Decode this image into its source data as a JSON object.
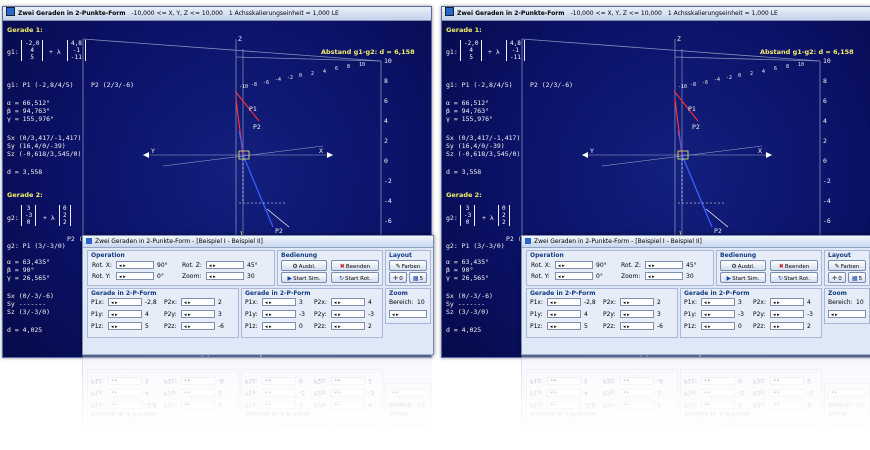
{
  "main_window": {
    "title": "Zwei Geraden in 2-Punkte-Form",
    "range_info": "-10,000 <= X, Y, Z <= 10,000",
    "scale_info": "1 Achsskalierungseinheit = 1,000 LE"
  },
  "info": {
    "gerade1_title": "Gerade 1:",
    "g1_label": "g1:",
    "g1_vec1": [
      "-2,0",
      "4",
      "5"
    ],
    "plus_lambda": "+ λ",
    "g1_vec2": [
      "4,8",
      "-1",
      "-11"
    ],
    "g1_points": "g1: P1 (-2,8/4/5)",
    "p2_label": "P2 (2/3/-6)",
    "alpha": "α = 66,512°",
    "beta": "β = 94,763°",
    "gamma": "γ = 155,976°",
    "sx1": "Sx (0/3,417/-1,417)",
    "sy1": "Sy (16,4/0/-39)",
    "sz1": "Sz (-0,618/3,545/0)",
    "d1": "d = 3,558",
    "gerade2_title": "Gerade 2:",
    "g2_label": "g2:",
    "g2_vec1": [
      "3",
      "-3",
      "0"
    ],
    "g2_vec2": [
      "0",
      "2",
      "2"
    ],
    "g2_points": "g2: P1 (3/-3/0)",
    "g2_points_right": "P2 (3/-1/2)",
    "alpha2": "α = 63,435°",
    "beta2": "β = 90°",
    "gamma2": "γ = 26,565°",
    "sx2": "Sx (0/-3/-6)",
    "sy2": "Sy -------",
    "sz2": "Sz (3/-3/0)",
    "d2": "d = 4,025"
  },
  "plot": {
    "abstand": "Abstand g1-g2: d = 6,158",
    "axis_x": "X",
    "axis_y": "Y",
    "axis_z": "Z",
    "p1": "P1",
    "p2": "P2",
    "p2b": "P2",
    "ticks_z": [
      "10",
      "8",
      "6",
      "4",
      "2",
      "0",
      "-2",
      "-4",
      "-6",
      "-8"
    ],
    "ticks_x": [
      "-10",
      "-8",
      "-6",
      "-4",
      "-2",
      "0",
      "2",
      "4",
      "6",
      "8",
      "10"
    ],
    "line_colors": {
      "g1": "#ff3030",
      "g2": "#3a5cff",
      "aux": "#ffffff"
    }
  },
  "dialog": {
    "title": "Zwei Geraden in 2-Punkte-Form - [Beispiel I - Beispiel II]",
    "operation": {
      "header": "Operation",
      "rotx_label": "Rot. X:",
      "rotx_value": "90°",
      "roty_label": "Rot. Y:",
      "roty_value": "0°",
      "rotz_label": "Rot. Z:",
      "rotz_value": "45°",
      "zoom_label": "Zoom:",
      "zoom_value": "30"
    },
    "bedienung": {
      "header": "Bedienung",
      "ausbl": "Ausbl.",
      "beenden": "Beenden",
      "start_sim": "Start Sim.",
      "start_rot": "Start Rot."
    },
    "layout": {
      "header": "Layout",
      "farben": "Farben",
      "btn_a": "0",
      "btn_b": "5"
    },
    "zoom": {
      "header": "Zoom",
      "bereich_label": "Bereich:",
      "bereich_value": "10"
    },
    "g1": {
      "header": "Gerade in 2-P-Form",
      "rows": [
        {
          "l1": "P1x:",
          "v1": "-2,8",
          "l2": "P2x:",
          "v2": "2"
        },
        {
          "l1": "P1y:",
          "v1": "4",
          "l2": "P2y:",
          "v2": "3"
        },
        {
          "l1": "P1z:",
          "v1": "5",
          "l2": "P2z:",
          "v2": "-6"
        }
      ]
    },
    "g2": {
      "header": "Gerade in 2-P-Form",
      "rows": [
        {
          "l1": "P1x:",
          "v1": "3",
          "l2": "P2x:",
          "v2": "4"
        },
        {
          "l1": "P1y:",
          "v1": "-3",
          "l2": "P2y:",
          "v2": "-3"
        },
        {
          "l1": "P1z:",
          "v1": "0",
          "l2": "P2z:",
          "v2": "2"
        }
      ]
    }
  }
}
